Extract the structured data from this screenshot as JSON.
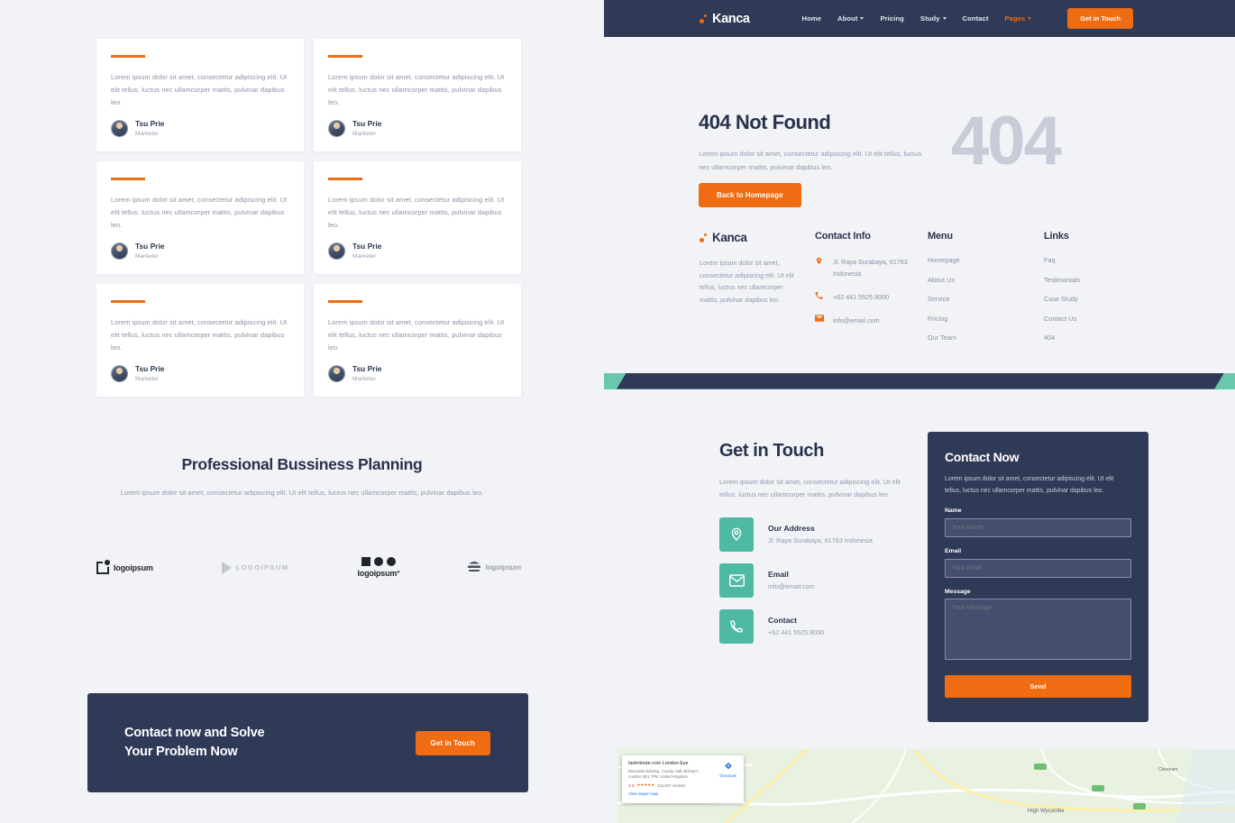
{
  "brand": {
    "name": "Kanca"
  },
  "nav": {
    "items": [
      {
        "label": "Home",
        "caret": false,
        "accent": false
      },
      {
        "label": "About",
        "caret": true,
        "accent": false
      },
      {
        "label": "Pricing",
        "caret": false,
        "accent": false
      },
      {
        "label": "Study",
        "caret": true,
        "accent": false
      },
      {
        "label": "Contact",
        "caret": false,
        "accent": false
      },
      {
        "label": "Pages",
        "caret": true,
        "accent": true
      }
    ],
    "cta_label": "Get in Touch"
  },
  "testimonials": {
    "cards": [
      {
        "text": "Lorem ipsum dolor sit amet, consectetur adipiscing elit. Ut elit tellus, luctus nec ullamcorper mattis, pulvinar dapibus leo.",
        "name": "Tsu Prie",
        "role": "Marketer"
      },
      {
        "text": "Lorem ipsum dolor sit amet, consectetur adipiscing elit. Ut elit tellus, luctus nec ullamcorper mattis, pulvinar dapibus leo.",
        "name": "Tsu Prie",
        "role": "Marketer"
      },
      {
        "text": "Lorem ipsum dolor sit amet, consectetur adipiscing elit. Ut elit tellus, luctus nec ullamcorper mattis, pulvinar dapibus leo.",
        "name": "Tsu Prie",
        "role": "Marketer"
      },
      {
        "text": "Lorem ipsum dolor sit amet, consectetur adipiscing elit. Ut elit tellus, luctus nec ullamcorper mattis, pulvinar dapibus leo.",
        "name": "Tsu Prie",
        "role": "Marketer"
      },
      {
        "text": "Lorem ipsum dolor sit amet, consectetur adipiscing elit. Ut elit tellus, luctus nec ullamcorper mattis, pulvinar dapibus leo.",
        "name": "Tsu Prie",
        "role": "Marketer"
      },
      {
        "text": "Lorem ipsum dolor sit amet, consectetur adipiscing elit. Ut elit tellus, luctus nec ullamcorper mattis, pulvinar dapibus leo.",
        "name": "Tsu Prie",
        "role": "Marketer"
      }
    ]
  },
  "planning": {
    "title": "Professional Bussiness Planning",
    "desc": "Lorem ipsum dolor sit amet, consectetur adipiscing elit. Ut elit tellus, luctus nec ullamcorper mattis, pulvinar dapibus leo.",
    "logos": [
      {
        "text": "logoipsum",
        "mark": "square-dot"
      },
      {
        "text": "LOGOIPSUM",
        "mark": "play-triangle"
      },
      {
        "text": "logoipsum°",
        "mark": "square-two-dots"
      },
      {
        "text": "logoipsum",
        "mark": "wave-circle"
      }
    ]
  },
  "cta_banner": {
    "line1": "Contact now and Solve",
    "line2": "Your Problem Now",
    "button": "Get in Touch"
  },
  "hero": {
    "title": "404 Not Found",
    "desc": "Lorem ipsum dolor sit amet, consectetur adipiscing elit. Ut elit tellus, luctus nec ullamcorper mattis, pulvinar dapibus leo.",
    "button": "Back to Homepage",
    "big_number": "404"
  },
  "footer": {
    "desc": "Lorem ipsum dolor sit amet, consectetur adipiscing elit. Ut elit tellus, luctus nec ullamcorper mattis, pulvinar dapibus leo.",
    "contact_title": "Contact Info",
    "contact_items": [
      {
        "icon": "location-pin-icon",
        "text": "Jl. Raya Surabaya, 61763 Indonesia"
      },
      {
        "icon": "phone-icon",
        "text": "+62 441 5525 8000"
      },
      {
        "icon": "envelope-icon",
        "text": "info@email.com"
      }
    ],
    "menu_title": "Menu",
    "menu_items": [
      "Homepage",
      "About Us",
      "Service",
      "Pricing",
      "Our Team"
    ],
    "links_title": "Links",
    "links_items": [
      "Faq",
      "Testimonials",
      "Case Study",
      "Contact Us",
      "404"
    ]
  },
  "get_in_touch": {
    "title": "Get in Touch",
    "desc": "Lorem ipsum dolor sit amet, consectetur adipiscing elit. Ut elit tellus, luctus nec ullamcorper mattis, pulvinar dapibus leo.",
    "items": [
      {
        "icon": "location-pin-icon",
        "title": "Our Address",
        "sub": "Jl. Raya Surabaya, 61763 Indonesia"
      },
      {
        "icon": "envelope-icon",
        "title": "Email",
        "sub": "info@email.com"
      },
      {
        "icon": "phone-icon",
        "title": "Contact",
        "sub": "+62 441 5525 8000"
      }
    ]
  },
  "form": {
    "title": "Contact Now",
    "desc": "Lorem ipsum dolor sit amet, consectetur adipiscing elit. Ut elit tellus, luctus nec ullamcorper mattis, pulvinar dapibus leo.",
    "name_label": "Name",
    "name_placeholder": "Your Name",
    "email_label": "Email",
    "email_placeholder": "Your Email",
    "message_label": "Message",
    "message_placeholder": "Your Message",
    "send_label": "Send"
  },
  "map": {
    "place": "lastminute.com London Eye",
    "address": "Riverside Building, County Hall, Bishop's, London SE1 7PB, United Kingdom",
    "rating": "4.5",
    "stars": "★★★★★",
    "reviews": "124,847 reviews",
    "view_larger": "View larger map",
    "directions": "Directions"
  },
  "colors": {
    "orange": "#ef6c12",
    "navy": "#2f3a56",
    "teal": "#4ebaa3",
    "band_teal": "#69c7ae",
    "page_bg": "#f2f3f7"
  }
}
